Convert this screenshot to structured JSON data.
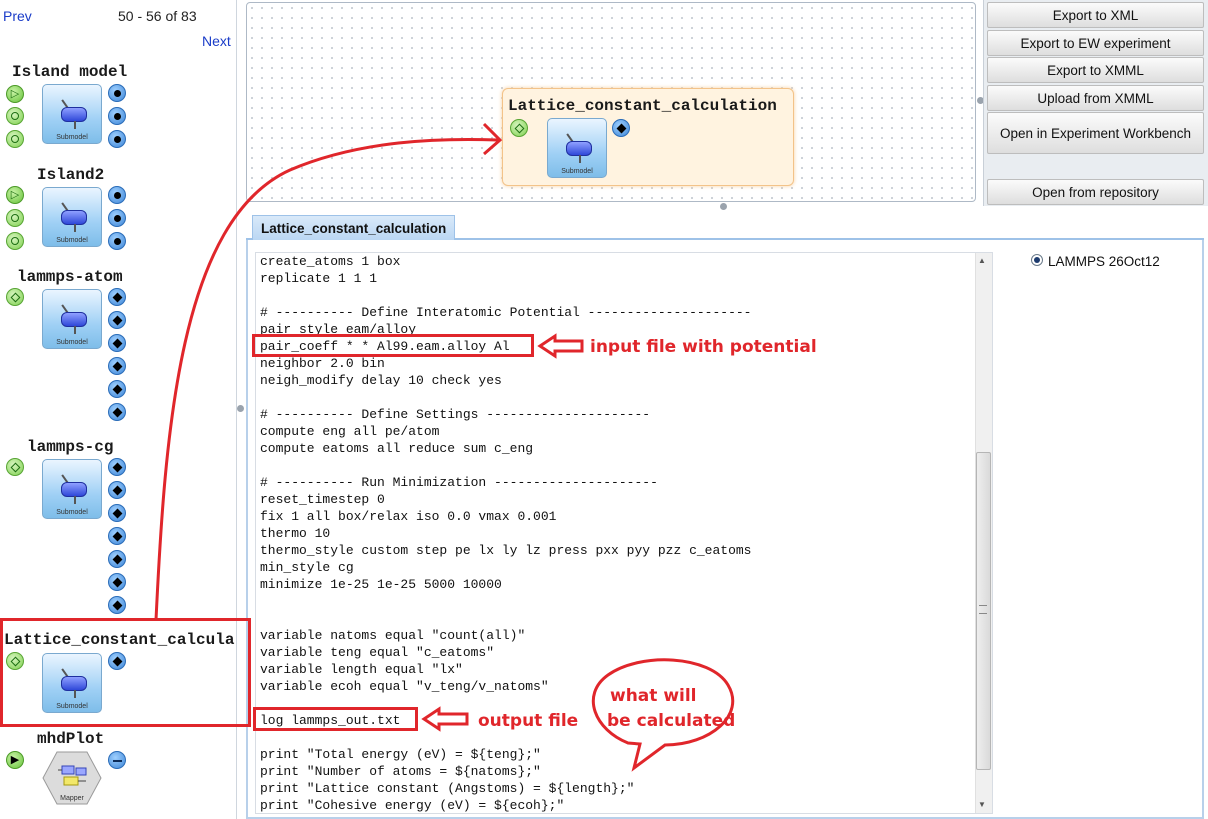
{
  "palette": {
    "prev_label": "Prev",
    "range_label": "50 - 56 of 83",
    "next_label": "Next",
    "components": [
      {
        "title": "Island model",
        "icon_caption": "Submodel"
      },
      {
        "title": "Island2",
        "icon_caption": "Submodel"
      },
      {
        "title": "lammps-atom",
        "icon_caption": "Submodel"
      },
      {
        "title": "lammps-cg",
        "icon_caption": "Submodel"
      },
      {
        "title": "Lattice_constant_calcula",
        "icon_caption": "Submodel"
      },
      {
        "title": "mhdPlot",
        "icon_caption": "Mapper"
      }
    ]
  },
  "canvas": {
    "node_title": "Lattice_constant_calculation",
    "node_icon_caption": "Submodel"
  },
  "toolbar": {
    "export_xml": "Export to XML",
    "export_ew": "Export to EW experiment",
    "export_xmml": "Export to XMML",
    "upload_xmml": "Upload from XMML",
    "open_workbench": "Open in Experiment Workbench",
    "open_repository": "Open from repository"
  },
  "editor": {
    "tab_label": "Lattice_constant_calculation",
    "code": "create_atoms 1 box\nreplicate 1 1 1\n\n# ---------- Define Interatomic Potential ---------------------\npair_style eam/alloy\npair_coeff * * Al99.eam.alloy Al\nneighbor 2.0 bin\nneigh_modify delay 10 check yes\n\n# ---------- Define Settings ---------------------\ncompute eng all pe/atom\ncompute eatoms all reduce sum c_eng\n\n# ---------- Run Minimization ---------------------\nreset_timestep 0\nfix 1 all box/relax iso 0.0 vmax 0.001\nthermo 10\nthermo_style custom step pe lx ly lz press pxx pyy pzz c_eatoms\nmin_style cg\nminimize 1e-25 1e-25 5000 10000\n\n\nvariable natoms equal \"count(all)\"\nvariable teng equal \"c_eatoms\"\nvariable length equal \"lx\"\nvariable ecoh equal \"v_teng/v_natoms\"\n\nlog lammps_out.txt\n\nprint \"Total energy (eV) = ${teng};\"\nprint \"Number of atoms = ${natoms};\"\nprint \"Lattice constant (Angstoms) = ${length};\"\nprint \"Cohesive energy (eV) = ${ecoh};\"",
    "version_option": "LAMMPS 26Oct12"
  },
  "annotations": {
    "input_file": "input file with potential",
    "output_file": "output file",
    "calc_line1": "what will",
    "calc_line2": "be calculated"
  },
  "colors": {
    "annotation_red": "#e0262b",
    "node_orange": "#fff3e0",
    "tab_blue": "#b9d6f3"
  }
}
